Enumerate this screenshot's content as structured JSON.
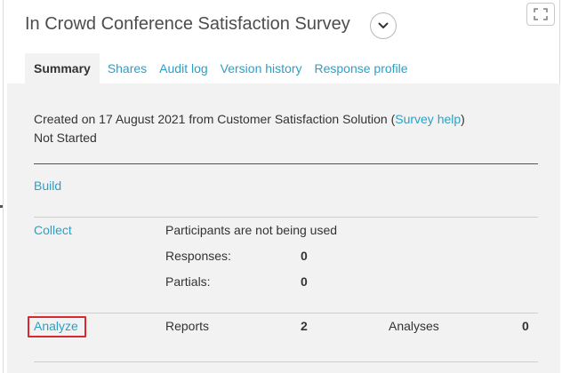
{
  "header": {
    "title": "In Crowd Conference Satisfaction Survey",
    "dropdown_icon": "chevron-down-icon",
    "expand_icon": "fullscreen-icon"
  },
  "tabs": [
    {
      "label": "Summary",
      "active": true
    },
    {
      "label": "Shares",
      "active": false
    },
    {
      "label": "Audit log",
      "active": false
    },
    {
      "label": "Version history",
      "active": false
    },
    {
      "label": "Response profile",
      "active": false
    }
  ],
  "summary": {
    "created_prefix": "Created on 17 August 2021 from Customer Satisfaction Solution (",
    "survey_help_label": "Survey help",
    "created_suffix": ")",
    "status": "Not Started"
  },
  "build": {
    "label": "Build"
  },
  "collect": {
    "label": "Collect",
    "participants_text": "Participants are not being used",
    "responses_label": "Responses:",
    "responses_value": "0",
    "partials_label": "Partials:",
    "partials_value": "0"
  },
  "analyze": {
    "label": "Analyze",
    "reports_label": "Reports",
    "reports_value": "2",
    "analyses_label": "Analyses",
    "analyses_value": "0"
  },
  "colors": {
    "link": "#2aa0c8",
    "highlight": "#d9282f",
    "panel_bg": "#f2f2f2"
  }
}
